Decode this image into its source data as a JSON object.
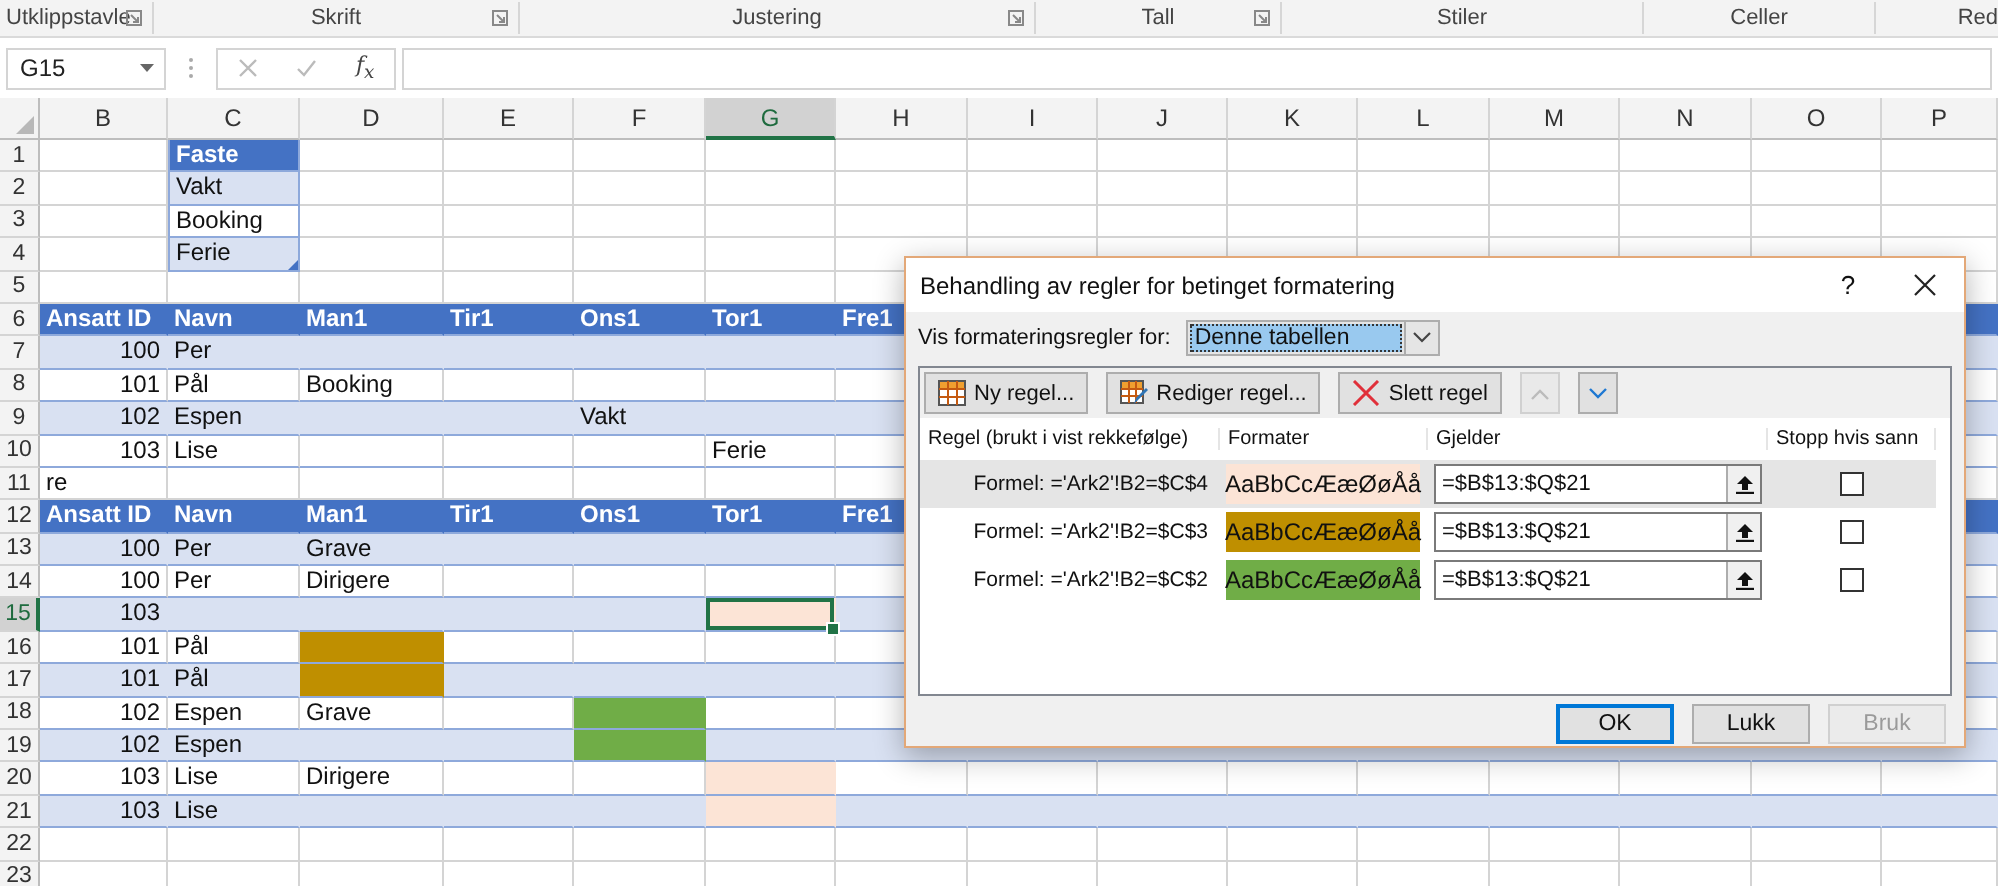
{
  "ribbon": {
    "groups": [
      {
        "label": "Utklippstavle",
        "launcher": true
      },
      {
        "label": "Skrift",
        "launcher": true
      },
      {
        "label": "Justering",
        "launcher": true
      },
      {
        "label": "Tall",
        "launcher": true
      },
      {
        "label": "Stiler",
        "launcher": false
      },
      {
        "label": "Celler",
        "launcher": false
      },
      {
        "label": "Red",
        "launcher": false
      }
    ]
  },
  "formula_bar": {
    "name_box": "G15",
    "function_label": "f$_{x}$"
  },
  "sheet": {
    "columns": [
      {
        "label": "B",
        "selected": false
      },
      {
        "label": "C",
        "selected": false
      },
      {
        "label": "D",
        "selected": false
      },
      {
        "label": "E",
        "selected": false
      },
      {
        "label": "F",
        "selected": false
      },
      {
        "label": "G",
        "selected": true
      },
      {
        "label": "H",
        "selected": false
      },
      {
        "label": "I",
        "selected": false
      },
      {
        "label": "J",
        "selected": false
      },
      {
        "label": "K",
        "selected": false
      },
      {
        "label": "L",
        "selected": false
      },
      {
        "label": "M",
        "selected": false
      },
      {
        "label": "N",
        "selected": false
      },
      {
        "label": "O",
        "selected": false
      },
      {
        "label": "P",
        "selected": false
      }
    ],
    "rows": [
      {
        "number": "1",
        "selected": false,
        "kind": "list_header",
        "cells": [
          null,
          {
            "text": "Faste",
            "kind": "text",
            "selected": false
          }
        ]
      },
      {
        "number": "2",
        "selected": false,
        "kind": "list_banded",
        "cells": [
          null,
          {
            "text": "Vakt",
            "kind": "text",
            "selected": false
          }
        ]
      },
      {
        "number": "3",
        "selected": false,
        "kind": "list_plain",
        "cells": [
          null,
          {
            "text": "Booking",
            "kind": "text",
            "selected": false
          }
        ]
      },
      {
        "number": "4",
        "selected": false,
        "kind": "list_banded",
        "cells": [
          null,
          {
            "text": "Ferie",
            "kind": "text",
            "selected": false,
            "resize_handle": true
          }
        ]
      },
      {
        "number": "5",
        "selected": false,
        "kind": "grid"
      },
      {
        "number": "6",
        "selected": false,
        "kind": "header",
        "cells": [
          {
            "text": "Ansatt ID",
            "kind": "text",
            "selected": false
          },
          {
            "text": "Navn",
            "kind": "text",
            "selected": false
          },
          {
            "text": "Man1",
            "kind": "text",
            "selected": false
          },
          {
            "text": "Tir1",
            "kind": "text",
            "selected": false
          },
          {
            "text": "Ons1",
            "kind": "text",
            "selected": false
          },
          {
            "text": "Tor1",
            "kind": "text",
            "selected": false
          },
          {
            "text": "Fre1",
            "kind": "text",
            "selected": false
          }
        ]
      },
      {
        "number": "7",
        "selected": false,
        "kind": "banded",
        "cells": [
          {
            "text": "100",
            "kind": "number",
            "selected": false
          },
          {
            "text": "Per",
            "kind": "text",
            "selected": false
          }
        ]
      },
      {
        "number": "8",
        "selected": false,
        "kind": "plain",
        "cells": [
          {
            "text": "101",
            "kind": "number",
            "selected": false
          },
          {
            "text": "Pål",
            "kind": "text",
            "selected": false
          },
          {
            "text": "Booking",
            "kind": "text",
            "selected": false
          }
        ]
      },
      {
        "number": "9",
        "selected": false,
        "kind": "banded",
        "cells": [
          {
            "text": "102",
            "kind": "number",
            "selected": false
          },
          {
            "text": "Espen",
            "kind": "text",
            "selected": false
          },
          null,
          null,
          {
            "text": "Vakt",
            "kind": "text",
            "selected": false
          }
        ]
      },
      {
        "number": "10",
        "selected": false,
        "kind": "plain",
        "cells": [
          {
            "text": "103",
            "kind": "number",
            "selected": false
          },
          {
            "text": "Lise",
            "kind": "text",
            "selected": false
          },
          null,
          null,
          null,
          {
            "text": "Ferie",
            "kind": "text",
            "selected": false
          }
        ]
      },
      {
        "number": "11",
        "selected": false,
        "kind": "grid",
        "cells": [
          {
            "text": "re",
            "kind": "text",
            "selected": false
          }
        ]
      },
      {
        "number": "12",
        "selected": false,
        "kind": "header",
        "cells": [
          {
            "text": "Ansatt ID",
            "kind": "text",
            "selected": false
          },
          {
            "text": "Navn",
            "kind": "text",
            "selected": false
          },
          {
            "text": "Man1",
            "kind": "text",
            "selected": false
          },
          {
            "text": "Tir1",
            "kind": "text",
            "selected": false
          },
          {
            "text": "Ons1",
            "kind": "text",
            "selected": false
          },
          {
            "text": "Tor1",
            "kind": "text",
            "selected": false
          },
          {
            "text": "Fre1",
            "kind": "text",
            "selected": false
          }
        ]
      },
      {
        "number": "13",
        "selected": false,
        "kind": "banded",
        "cells": [
          {
            "text": "100",
            "kind": "number",
            "selected": false
          },
          {
            "text": "Per",
            "kind": "text",
            "selected": false
          },
          {
            "text": "Grave",
            "kind": "text",
            "selected": false
          }
        ]
      },
      {
        "number": "14",
        "selected": false,
        "kind": "plain",
        "cells": [
          {
            "text": "100",
            "kind": "number",
            "selected": false
          },
          {
            "text": "Per",
            "kind": "text",
            "selected": false
          },
          {
            "text": "Dirigere",
            "kind": "text",
            "selected": false
          }
        ]
      },
      {
        "number": "15",
        "selected": true,
        "kind": "banded",
        "cells": [
          {
            "text": "103",
            "kind": "number",
            "selected": false
          },
          null,
          null,
          null,
          null,
          {
            "kind": "fill",
            "color": "#fce4d6",
            "selected": true
          }
        ]
      },
      {
        "number": "16",
        "selected": false,
        "kind": "plain",
        "cells": [
          {
            "text": "101",
            "kind": "number",
            "selected": false
          },
          {
            "text": "Pål",
            "kind": "text",
            "selected": false
          },
          {
            "kind": "fill",
            "color": "#bf8f00",
            "selected": false
          }
        ]
      },
      {
        "number": "17",
        "selected": false,
        "kind": "banded",
        "cells": [
          {
            "text": "101",
            "kind": "number",
            "selected": false
          },
          {
            "text": "Pål",
            "kind": "text",
            "selected": false
          },
          {
            "kind": "fill",
            "color": "#bf8f00",
            "selected": false
          }
        ]
      },
      {
        "number": "18",
        "selected": false,
        "kind": "plain",
        "cells": [
          {
            "text": "102",
            "kind": "number",
            "selected": false
          },
          {
            "text": "Espen",
            "kind": "text",
            "selected": false
          },
          {
            "text": "Grave",
            "kind": "text",
            "selected": false
          },
          null,
          {
            "kind": "fill",
            "color": "#70ad47",
            "selected": false
          }
        ]
      },
      {
        "number": "19",
        "selected": false,
        "kind": "banded",
        "cells": [
          {
            "text": "102",
            "kind": "number",
            "selected": false
          },
          {
            "text": "Espen",
            "kind": "text",
            "selected": false
          },
          null,
          null,
          {
            "kind": "fill",
            "color": "#70ad47",
            "selected": false
          }
        ]
      },
      {
        "number": "20",
        "selected": false,
        "kind": "plain",
        "cells": [
          {
            "text": "103",
            "kind": "number",
            "selected": false
          },
          {
            "text": "Lise",
            "kind": "text",
            "selected": false
          },
          {
            "text": "Dirigere",
            "kind": "text",
            "selected": false
          },
          null,
          null,
          {
            "kind": "fill",
            "color": "#fce4d6",
            "selected": false
          }
        ]
      },
      {
        "number": "21",
        "selected": false,
        "kind": "banded",
        "cells": [
          {
            "text": "103",
            "kind": "number",
            "selected": false
          },
          {
            "text": "Lise",
            "kind": "text",
            "selected": false
          },
          null,
          null,
          null,
          {
            "kind": "fill",
            "color": "#fce4d6",
            "selected": false
          }
        ]
      },
      {
        "number": "22",
        "selected": false,
        "kind": "grid"
      },
      {
        "number": "23",
        "selected": false,
        "kind": "grid"
      }
    ]
  },
  "dialog": {
    "title": "Behandling av regler for betinget formatering",
    "help": "?",
    "scope_label": "Vis formateringsregler for:",
    "scope_value": "Denne tabellen",
    "toolbar": [
      {
        "kind": "new",
        "label": "Ny regel...",
        "disabled": false
      },
      {
        "kind": "edit",
        "label": "Rediger regel...",
        "disabled": false
      },
      {
        "kind": "delete",
        "label": "Slett regel",
        "disabled": false
      },
      {
        "kind": "up",
        "disabled": true
      },
      {
        "kind": "down",
        "disabled": false
      }
    ],
    "columns": [
      "Regel (brukt i vist rekkefølge)",
      "Formater",
      "Gjelder",
      "Stopp hvis sann"
    ],
    "rules": [
      {
        "rule": "Formel: ='Ark2'!B2=$C$4",
        "preview": "AaBbCcÆæØøÅå",
        "color": "#fce4d6",
        "applies_to": "=$B$13:$Q$21",
        "stop": false,
        "selected": true
      },
      {
        "rule": "Formel: ='Ark2'!B2=$C$3",
        "preview": "AaBbCcÆæØøÅå",
        "color": "#bf8f00",
        "applies_to": "=$B$13:$Q$21",
        "stop": false,
        "selected": false
      },
      {
        "rule": "Formel: ='Ark2'!B2=$C$2",
        "preview": "AaBbCcÆæØøÅå",
        "color": "#70ad47",
        "applies_to": "=$B$13:$Q$21",
        "stop": false,
        "selected": false
      }
    ],
    "buttons": [
      {
        "label": "OK",
        "kind": "default",
        "disabled": false
      },
      {
        "label": "Lukk",
        "kind": "normal",
        "disabled": false
      },
      {
        "label": "Bruk",
        "kind": "normal",
        "disabled": true
      }
    ]
  }
}
